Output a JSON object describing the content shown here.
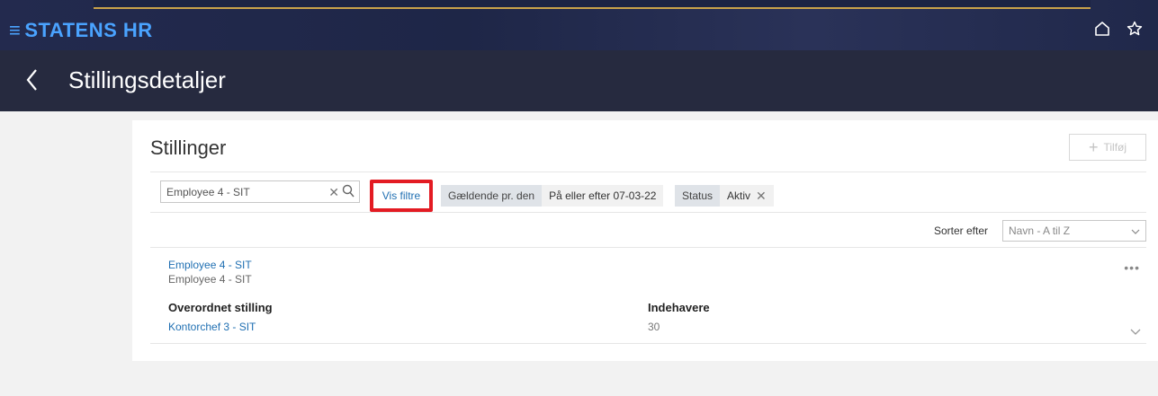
{
  "app": {
    "brand": "STATENS HR",
    "icons": {
      "menu": "hamburger-icon",
      "home": "home-icon",
      "favorite": "star-icon"
    }
  },
  "header": {
    "title": "Stillingsdetaljer",
    "back_icon": "chevron-left-icon"
  },
  "card": {
    "title": "Stillinger",
    "add_label": "Tilføj",
    "search": {
      "value": "Employee 4 - SIT"
    },
    "filters_button": "Vis filtre",
    "filter_chips": [
      {
        "label": "Gældende pr. den",
        "value": "På eller efter 07-03-22",
        "removable": false
      },
      {
        "label": "Status",
        "value": "Aktiv",
        "removable": true
      }
    ],
    "sort": {
      "label": "Sorter efter",
      "selected": "Navn - A til Z"
    }
  },
  "results": [
    {
      "name": "Employee 4 - SIT",
      "subtitle": "Employee 4 - SIT",
      "parent_label": "Overordnet stilling",
      "parent_value": "Kontorchef 3 - SIT",
      "holders_label": "Indehavere",
      "holders_value": "30"
    }
  ],
  "colors": {
    "brand_blue": "#4aa3ff",
    "link_blue": "#1f6fb2",
    "title_bar": "#262a3f",
    "highlight_red": "#e31b23"
  }
}
